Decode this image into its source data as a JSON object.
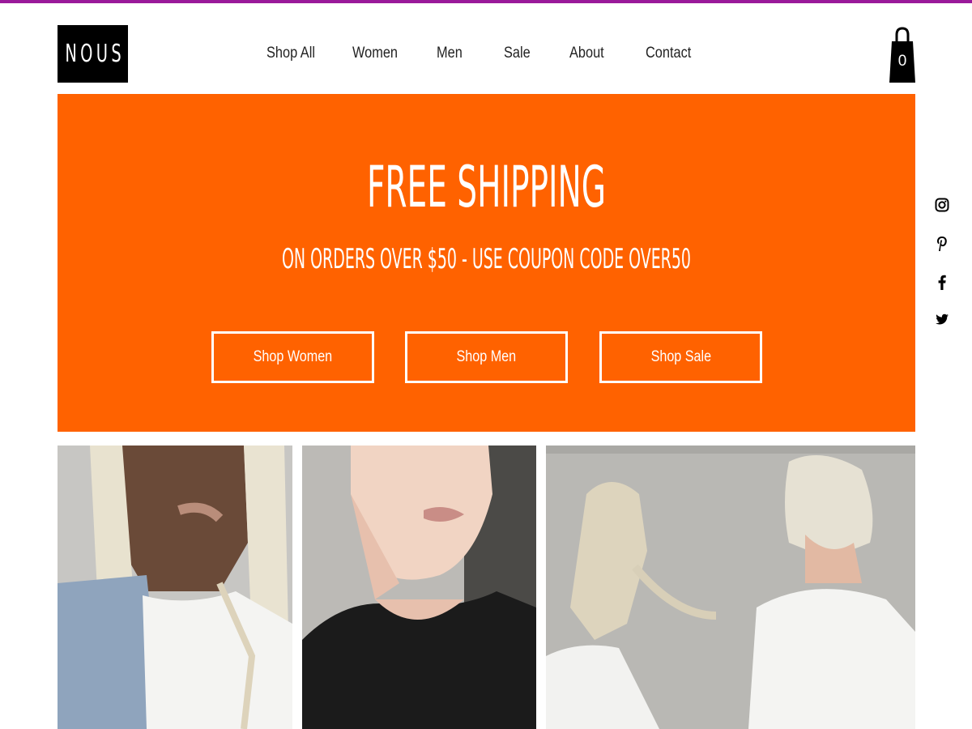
{
  "brand": {
    "logo_text": "NOUS"
  },
  "nav": {
    "items": [
      {
        "label": "Shop All"
      },
      {
        "label": "Women"
      },
      {
        "label": "Men"
      },
      {
        "label": "Sale"
      },
      {
        "label": "About"
      },
      {
        "label": "Contact"
      }
    ]
  },
  "cart": {
    "count": "0",
    "icon": "shopping-bag-icon"
  },
  "hero": {
    "background": "#ff6200",
    "headline": "FREE SHIPPING",
    "subline": "ON ORDERS OVER $50 - USE COUPON CODE OVER50",
    "buttons": [
      {
        "label": "Shop Women"
      },
      {
        "label": "Shop Men"
      },
      {
        "label": "Shop Sale"
      }
    ]
  },
  "social": {
    "icons": [
      "instagram-icon",
      "pinterest-icon",
      "facebook-icon",
      "twitter-icon"
    ]
  },
  "gallery": {
    "images": [
      "photo-woman-braids",
      "photo-man-blond",
      "photo-two-models"
    ]
  },
  "colors": {
    "accent": "#ff6200",
    "top_strip": "#9a1a9a",
    "text": "#222222"
  }
}
